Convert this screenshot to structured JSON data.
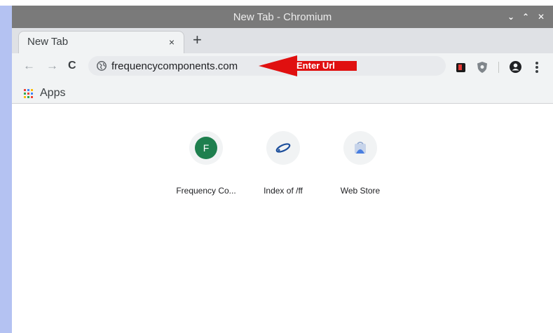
{
  "window": {
    "title": "New Tab - Chromium",
    "controls": {
      "minimize": "⌄",
      "maximize": "⌃",
      "close": "✕"
    }
  },
  "tabs": [
    {
      "title": "New Tab",
      "close_glyph": "×"
    }
  ],
  "new_tab_glyph": "+",
  "toolbar": {
    "back_glyph": "←",
    "forward_glyph": "→",
    "reload_glyph": "C",
    "url": "frequencycomponents.com",
    "annotation": "Enter Url",
    "icons": [
      "back-icon",
      "forward-icon",
      "reload-icon",
      "globe-icon",
      "extension-icon",
      "shield-extension-icon",
      "account-icon",
      "menu-icon"
    ]
  },
  "bookmarks": {
    "apps_label": "Apps"
  },
  "shortcuts": [
    {
      "title": "Frequency Co...",
      "icon_letter": "F",
      "icon_color": "#1e7f4e"
    },
    {
      "title": "Index of /ff",
      "icon_color": "#1d4f9c"
    },
    {
      "title": "Web Store",
      "icon_color": "#4a7fe0"
    }
  ],
  "colors": {
    "titlebar": "#7a7a7a",
    "tabstrip": "#dfe1e5",
    "toolbar": "#f1f3f4",
    "annotation_arrow": "#e01010",
    "desktop": "#b4c2f2"
  }
}
